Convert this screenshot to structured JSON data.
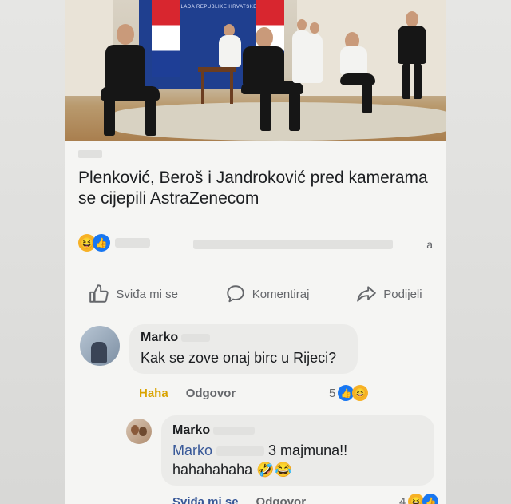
{
  "headline": {
    "title": "Plenković, Beroš i Jandroković pred kamerama se cijepili AstraZenecom"
  },
  "stats": {
    "reactions_suffix": "a"
  },
  "actions": {
    "like_label": "Sviđa mi se",
    "comment_label": "Komentiraj",
    "share_label": "Podijeli"
  },
  "comments": [
    {
      "author": "Marko",
      "text": "Kak se zove onaj birc u Rijeci?",
      "reaction_label": "Haha",
      "reply_label": "Odgovor",
      "reaction_count": "5"
    },
    {
      "author": "Marko",
      "mention": "Marko",
      "text_after_mention": "3 majmuna!!",
      "text_line2": "hahahahaha",
      "like_label": "Sviđa mi se",
      "reply_label": "Odgovor",
      "reaction_count": "4"
    }
  ],
  "photo": {
    "banner_text": "VLADA REPUBLIKE HRVATSKE"
  },
  "colors": {
    "like_blue": "#1877f2",
    "haha_yellow": "#f7b125",
    "mention_blue": "#385898"
  }
}
